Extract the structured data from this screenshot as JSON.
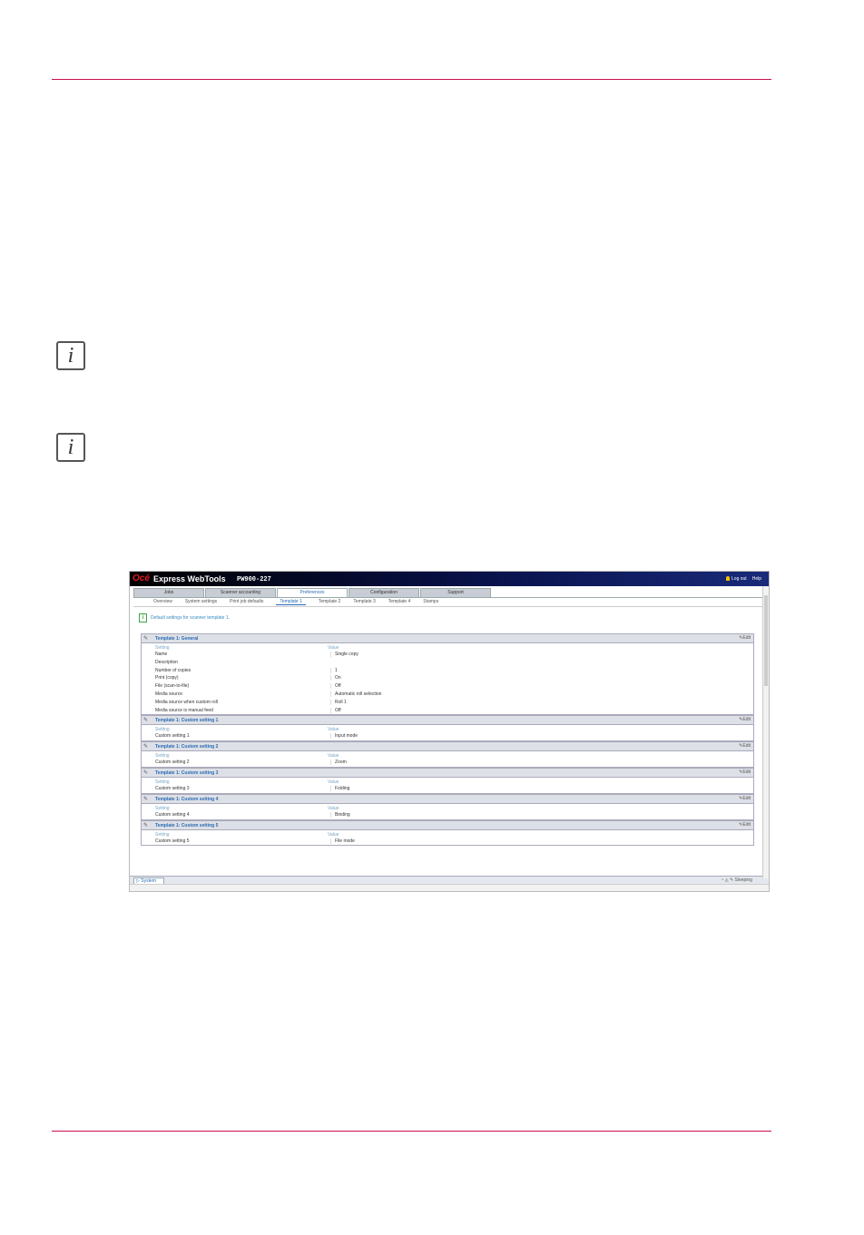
{
  "webtools": {
    "logo": "Océ",
    "title": "Express WebTools",
    "model": "PW900-227",
    "user_actions": [
      "Log out",
      "Help"
    ],
    "tabs": [
      {
        "label": "Jobs",
        "active": false
      },
      {
        "label": "Scanner accounting",
        "active": false
      },
      {
        "label": "Preferences",
        "active": true
      },
      {
        "label": "Configuration",
        "active": false
      },
      {
        "label": "Support",
        "active": false
      }
    ],
    "subtabs": [
      {
        "label": "Overview",
        "active": false
      },
      {
        "label": "System settings",
        "active": false
      },
      {
        "label": "Print job defaults",
        "active": false
      },
      {
        "label": "Template 1",
        "active": true
      },
      {
        "label": "Template 2",
        "active": false
      },
      {
        "label": "Template 3",
        "active": false
      },
      {
        "label": "Template 4",
        "active": false
      },
      {
        "label": "Stamps",
        "active": false
      }
    ],
    "notice": "Default settings for scanner template 1.",
    "col_setting": "Setting",
    "col_value": "Value",
    "edit_label": "Edit",
    "sections": [
      {
        "title": "Template 1: General",
        "rows": [
          {
            "setting": "Name",
            "value": "Single copy"
          },
          {
            "setting": "Description",
            "value": ""
          },
          {
            "setting": "Number of copies",
            "value": "1"
          },
          {
            "setting": "Print (copy)",
            "value": "On"
          },
          {
            "setting": "File (scan-to-file)",
            "value": "Off"
          },
          {
            "setting": "Media source",
            "value": "Automatic roll selection"
          },
          {
            "setting": "Media source when custom roll",
            "value": "Roll 1"
          },
          {
            "setting": "Media source is manual feed",
            "value": "Off"
          }
        ]
      },
      {
        "title": "Template 1: Custom setting 1",
        "rows": [
          {
            "setting": "Custom setting 1",
            "value": "Input mode"
          }
        ]
      },
      {
        "title": "Template 1: Custom setting 2",
        "rows": [
          {
            "setting": "Custom setting 2",
            "value": "Zoom"
          }
        ]
      },
      {
        "title": "Template 1: Custom setting 3",
        "rows": [
          {
            "setting": "Custom setting 3",
            "value": "Folding"
          }
        ]
      },
      {
        "title": "Template 1: Custom setting 4",
        "rows": [
          {
            "setting": "Custom setting 4",
            "value": "Binding"
          }
        ]
      },
      {
        "title": "Template 1: Custom setting 5",
        "rows": [
          {
            "setting": "Custom setting 5",
            "value": "File mode"
          }
        ]
      }
    ],
    "status_left": "System",
    "status_right": "Sleeping"
  }
}
